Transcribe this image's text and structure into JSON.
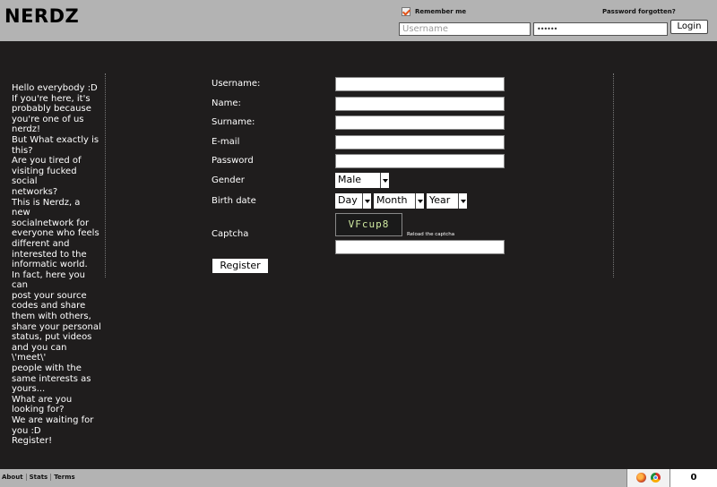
{
  "header": {
    "logo": "NERDZ",
    "remember_me": "Remember me",
    "password_forgotten": "Password forgotten?",
    "username_placeholder": "Username",
    "password_mask": "••••••",
    "login_label": "Login"
  },
  "sidebar": {
    "lines": [
      "Hello everybody :D",
      "If you're here, it's",
      "probably because",
      "you're one of us",
      "nerdz!",
      "But What exactly is",
      "this?",
      "Are you tired of",
      "visiting fucked social",
      "networks?",
      "This is Nerdz, a new",
      "socialnetwork for",
      "everyone who feels",
      "different and",
      "interested to the",
      "informatic world.",
      "In fact, here you can",
      "post your source",
      "codes and share",
      "them with others,",
      "share your personal",
      "status, put videos",
      "and you can \\'meet\\'",
      "people with the",
      "same interests as",
      "yours...",
      "What are you",
      "looking for?",
      "We are waiting for",
      "you :D",
      "Register!"
    ]
  },
  "form": {
    "username_label": "Username:",
    "name_label": "Name:",
    "surname_label": "Surname:",
    "email_label": "E-mail",
    "password_label": "Password",
    "gender_label": "Gender",
    "gender_value": "Male",
    "birth_label": "Birth date",
    "day_value": "Day",
    "month_value": "Month",
    "year_value": "Year",
    "captcha_label": "Captcha",
    "captcha_text": "VFcup8",
    "reload_captcha": "Reload the captcha",
    "register_label": "Register"
  },
  "footer": {
    "links": [
      "About",
      "Stats",
      "Terms"
    ],
    "counter": "0"
  }
}
